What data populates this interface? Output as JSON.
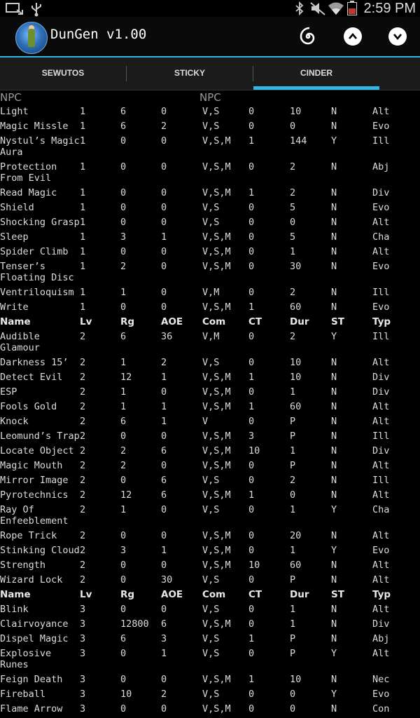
{
  "status_bar": {
    "time": "2:59 PM",
    "icons": [
      "screen-cast-icon",
      "usb-icon",
      "bluetooth-icon",
      "mute-icon",
      "wifi-icon",
      "battery-icon"
    ],
    "battery_color": "#c0392b"
  },
  "app": {
    "title": "DunGen v1.00",
    "accent_color": "#33b5e5",
    "actions": [
      "spiral-icon",
      "chevron-up-icon",
      "chevron-down-icon"
    ]
  },
  "tabs": [
    {
      "label": "SEWUTOS",
      "selected": false
    },
    {
      "label": "STICKY",
      "selected": false
    },
    {
      "label": "CINDER",
      "selected": true
    }
  ],
  "list_header": {
    "left": "NPC",
    "center": "NPC"
  },
  "header_labels": {
    "name": "Name",
    "lv": "Lv",
    "rg": "Rg",
    "aoe": "AOE",
    "com": "Com",
    "ct": "CT",
    "dur": "Dur",
    "st": "ST",
    "typ": "Typ"
  },
  "rows": [
    {
      "name": "Light",
      "lv": "1",
      "rg": "6",
      "aoe": "0",
      "com": "V,S",
      "ct": "0",
      "dur": "10",
      "st": "N",
      "typ": "Alt"
    },
    {
      "name": "Magic Missle",
      "lv": "1",
      "rg": "6",
      "aoe": "2",
      "com": "V,S",
      "ct": "0",
      "dur": "0",
      "st": "N",
      "typ": "Evo"
    },
    {
      "name": "Nystul’s Magic Aura",
      "lv": "1",
      "rg": "0",
      "aoe": "0",
      "com": "V,S,M",
      "ct": "1",
      "dur": "144",
      "st": "Y",
      "typ": "Ill",
      "tall": true
    },
    {
      "name": "Protection From Evil",
      "lv": "1",
      "rg": "0",
      "aoe": "0",
      "com": "V,S,M",
      "ct": "0",
      "dur": "2",
      "st": "N",
      "typ": "Abj",
      "tall": true
    },
    {
      "name": "Read Magic",
      "lv": "1",
      "rg": "0",
      "aoe": "0",
      "com": "V,S,M",
      "ct": "1",
      "dur": "2",
      "st": "N",
      "typ": "Div"
    },
    {
      "name": "Shield",
      "lv": "1",
      "rg": "0",
      "aoe": "0",
      "com": "V,S",
      "ct": "0",
      "dur": "5",
      "st": "N",
      "typ": "Evo"
    },
    {
      "name": "Shocking Grasp",
      "lv": "1",
      "rg": "0",
      "aoe": "0",
      "com": "V,S",
      "ct": "0",
      "dur": "0",
      "st": "N",
      "typ": "Alt"
    },
    {
      "name": "Sleep",
      "lv": "1",
      "rg": "3",
      "aoe": "1",
      "com": "V,S,M",
      "ct": "0",
      "dur": "5",
      "st": "N",
      "typ": "Cha"
    },
    {
      "name": "Spider Climb",
      "lv": "1",
      "rg": "0",
      "aoe": "0",
      "com": "V,S,M",
      "ct": "0",
      "dur": "1",
      "st": "N",
      "typ": "Alt"
    },
    {
      "name": "Tenser’s Floating Disc",
      "lv": "1",
      "rg": "2",
      "aoe": "0",
      "com": "V,S,M",
      "ct": "0",
      "dur": "30",
      "st": "N",
      "typ": "Evo",
      "tall": true
    },
    {
      "name": "Ventriloquism",
      "lv": "1",
      "rg": "1",
      "aoe": "0",
      "com": "V,M",
      "ct": "0",
      "dur": "2",
      "st": "N",
      "typ": "Ill"
    },
    {
      "name": "Write",
      "lv": "1",
      "rg": "0",
      "aoe": "0",
      "com": "V,S,M",
      "ct": "1",
      "dur": "60",
      "st": "N",
      "typ": "Evo"
    },
    {
      "header": true
    },
    {
      "name": "Audible Glamour",
      "lv": "2",
      "rg": "6",
      "aoe": "36",
      "com": "V,M",
      "ct": "0",
      "dur": "2",
      "st": "Y",
      "typ": "Ill",
      "tall": true
    },
    {
      "name": "Darkness 15’",
      "lv": "2",
      "rg": "1",
      "aoe": "2",
      "com": "V,S",
      "ct": "0",
      "dur": "10",
      "st": "N",
      "typ": "Alt"
    },
    {
      "name": "Detect Evil",
      "lv": "2",
      "rg": "12",
      "aoe": "1",
      "com": "V,S,M",
      "ct": "1",
      "dur": "10",
      "st": "N",
      "typ": "Div"
    },
    {
      "name": "ESP",
      "lv": "2",
      "rg": "1",
      "aoe": "0",
      "com": "V,S,M",
      "ct": "0",
      "dur": "1",
      "st": "N",
      "typ": "Div"
    },
    {
      "name": "Fools Gold",
      "lv": "2",
      "rg": "1",
      "aoe": "1",
      "com": "V,S,M",
      "ct": "1",
      "dur": "60",
      "st": "N",
      "typ": "Alt"
    },
    {
      "name": "Knock",
      "lv": "2",
      "rg": "6",
      "aoe": "1",
      "com": "V",
      "ct": "0",
      "dur": "P",
      "st": "N",
      "typ": "Alt"
    },
    {
      "name": "Leomund’s Trap",
      "lv": "2",
      "rg": "0",
      "aoe": "0",
      "com": "V,S,M",
      "ct": "3",
      "dur": "P",
      "st": "N",
      "typ": "Ill"
    },
    {
      "name": "Locate Object",
      "lv": "2",
      "rg": "2",
      "aoe": "6",
      "com": "V,S,M",
      "ct": "10",
      "dur": "1",
      "st": "N",
      "typ": "Div"
    },
    {
      "name": "Magic Mouth",
      "lv": "2",
      "rg": "2",
      "aoe": "0",
      "com": "V,S,M",
      "ct": "0",
      "dur": "P",
      "st": "N",
      "typ": "Alt"
    },
    {
      "name": "Mirror Image",
      "lv": "2",
      "rg": "0",
      "aoe": "6",
      "com": "V,S",
      "ct": "0",
      "dur": "2",
      "st": "N",
      "typ": "Ill"
    },
    {
      "name": "Pyrotechnics",
      "lv": "2",
      "rg": "12",
      "aoe": "6",
      "com": "V,S,M",
      "ct": "1",
      "dur": "0",
      "st": "N",
      "typ": "Alt"
    },
    {
      "name": "Ray Of Enfeeblement",
      "lv": "2",
      "rg": "1",
      "aoe": "0",
      "com": "V,S",
      "ct": "0",
      "dur": "1",
      "st": "Y",
      "typ": "Cha",
      "tall": true
    },
    {
      "name": "Rope Trick",
      "lv": "2",
      "rg": "0",
      "aoe": "0",
      "com": "V,S,M",
      "ct": "0",
      "dur": "20",
      "st": "N",
      "typ": "Alt"
    },
    {
      "name": "Stinking Cloud",
      "lv": "2",
      "rg": "3",
      "aoe": "1",
      "com": "V,S,M",
      "ct": "0",
      "dur": "1",
      "st": "Y",
      "typ": "Evo"
    },
    {
      "name": "Strength",
      "lv": "2",
      "rg": "0",
      "aoe": "0",
      "com": "V,S,M",
      "ct": "10",
      "dur": "60",
      "st": "N",
      "typ": "Alt"
    },
    {
      "name": "Wizard Lock",
      "lv": "2",
      "rg": "0",
      "aoe": "30",
      "com": "V,S",
      "ct": "0",
      "dur": "P",
      "st": "N",
      "typ": "Alt"
    },
    {
      "header": true
    },
    {
      "name": "Blink",
      "lv": "3",
      "rg": "0",
      "aoe": "0",
      "com": "V,S",
      "ct": "0",
      "dur": "1",
      "st": "N",
      "typ": "Alt"
    },
    {
      "name": "Clairvoyance",
      "lv": "3",
      "rg": "12800",
      "aoe": "6",
      "com": "V,S,M",
      "ct": "0",
      "dur": "1",
      "st": "N",
      "typ": "Div"
    },
    {
      "name": "Dispel Magic",
      "lv": "3",
      "rg": "6",
      "aoe": "3",
      "com": "V,S",
      "ct": "1",
      "dur": "P",
      "st": "N",
      "typ": "Abj"
    },
    {
      "name": "Explosive Runes",
      "lv": "3",
      "rg": "0",
      "aoe": "1",
      "com": "V,S",
      "ct": "0",
      "dur": "P",
      "st": "Y",
      "typ": "Alt",
      "tall": true
    },
    {
      "name": "Feign Death",
      "lv": "3",
      "rg": "0",
      "aoe": "0",
      "com": "V,S,M",
      "ct": "1",
      "dur": "10",
      "st": "N",
      "typ": "Nec"
    },
    {
      "name": "Fireball",
      "lv": "3",
      "rg": "10",
      "aoe": "2",
      "com": "V,S",
      "ct": "0",
      "dur": "0",
      "st": "Y",
      "typ": "Evo"
    },
    {
      "name": "Flame Arrow",
      "lv": "3",
      "rg": "0",
      "aoe": "0",
      "com": "V,S,M",
      "ct": "0",
      "dur": "0",
      "st": "N",
      "typ": "Con"
    }
  ]
}
